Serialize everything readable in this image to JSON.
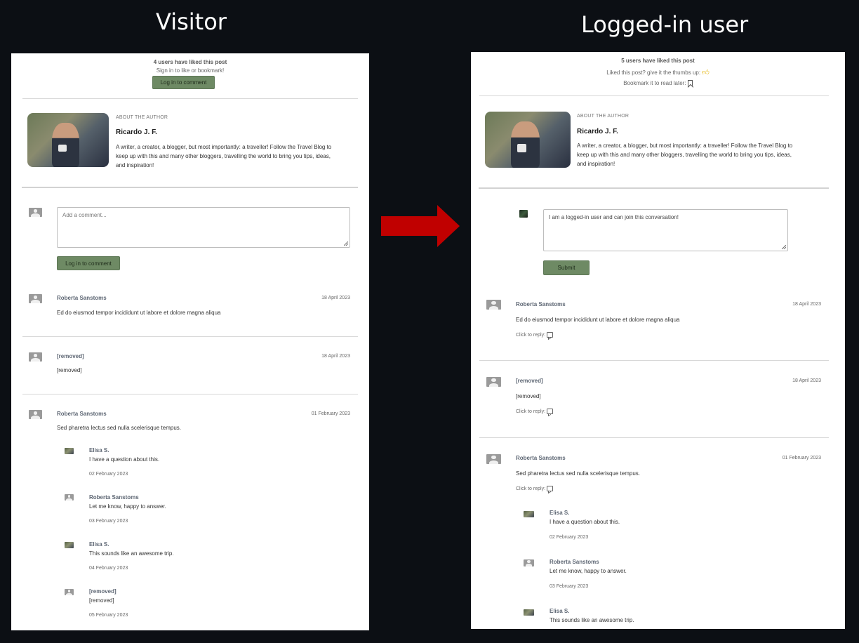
{
  "headings": {
    "left": "Visitor",
    "right": "Logged-in user"
  },
  "colors": {
    "background": "#0c0f14",
    "button": "#6e8a64",
    "arrow": "#c00000",
    "thumb": "#e2b100"
  },
  "visitor": {
    "likes_title": "4 users have liked this post",
    "signin_text": "Sign in to like or bookmark!",
    "top_button": "Log in to comment",
    "about_label": "ABOUT THE AUTHOR",
    "author_name": "Ricardo J. F.",
    "author_bio_lines": [
      "A writer, a creator, a blogger, but most importantly: a traveller! Follow the Travel Blog to",
      "keep up with this and many other bloggers, travelling the world to bring you tips, ideas,",
      "and inspiration!"
    ],
    "comment_placeholder": "Add a comment...",
    "comment_button": "Log in to comment",
    "comments": [
      {
        "name": "Roberta Sanstoms",
        "date": "18 April 2023",
        "text": "Ed do eiusmod tempor incididunt ut labore et dolore magna aliqua"
      },
      {
        "name": "[removed]",
        "date": "18 April 2023",
        "text": "[removed]"
      },
      {
        "name": "Roberta Sanstoms",
        "date": "01 February 2023",
        "text": "Sed pharetra lectus sed nulla scelerisque tempus."
      }
    ],
    "replies": [
      {
        "name": "Elisa S.",
        "text": "I have a question about this.",
        "date": "02 February 2023"
      },
      {
        "name": "Roberta Sanstoms",
        "text": "Let me know, happy to answer.",
        "date": "03 February 2023"
      },
      {
        "name": "Elisa S.",
        "text": "This sounds like an awesome trip.",
        "date": "04 February 2023"
      },
      {
        "name": "[removed]",
        "text": "[removed]",
        "date": "05 February 2023"
      }
    ]
  },
  "user": {
    "likes_title": "5 users have liked this post",
    "liked_text": "Liked this post? give it the thumbs up:",
    "bookmark_text": "Bookmark it to read later:",
    "about_label": "ABOUT THE AUTHOR",
    "author_name": "Ricardo J. F.",
    "author_bio_lines": [
      "A writer, a creator, a blogger, but most importantly: a traveller! Follow the Travel Blog to",
      "keep up with this and many other bloggers, travelling the world to bring you tips, ideas,",
      "and inspiration!"
    ],
    "comment_value": "I am a logged-in user and can join this conversation!",
    "submit_button": "Submit",
    "reply_label": "Click to reply:",
    "comments": [
      {
        "name": "Roberta Sanstoms",
        "date": "18 April 2023",
        "text": "Ed do eiusmod tempor incididunt ut labore et dolore magna aliqua"
      },
      {
        "name": "[removed]",
        "date": "18 April 2023",
        "text": "[removed]"
      },
      {
        "name": "Roberta Sanstoms",
        "date": "01 February 2023",
        "text": "Sed pharetra lectus sed nulla scelerisque tempus."
      }
    ],
    "replies": [
      {
        "name": "Elisa S.",
        "text": "I have a question about this.",
        "date": "02 February 2023"
      },
      {
        "name": "Roberta Sanstoms",
        "text": "Let me know, happy to answer.",
        "date": "03 February 2023"
      },
      {
        "name": "Elisa S.",
        "text": "This sounds like an awesome trip."
      }
    ]
  }
}
